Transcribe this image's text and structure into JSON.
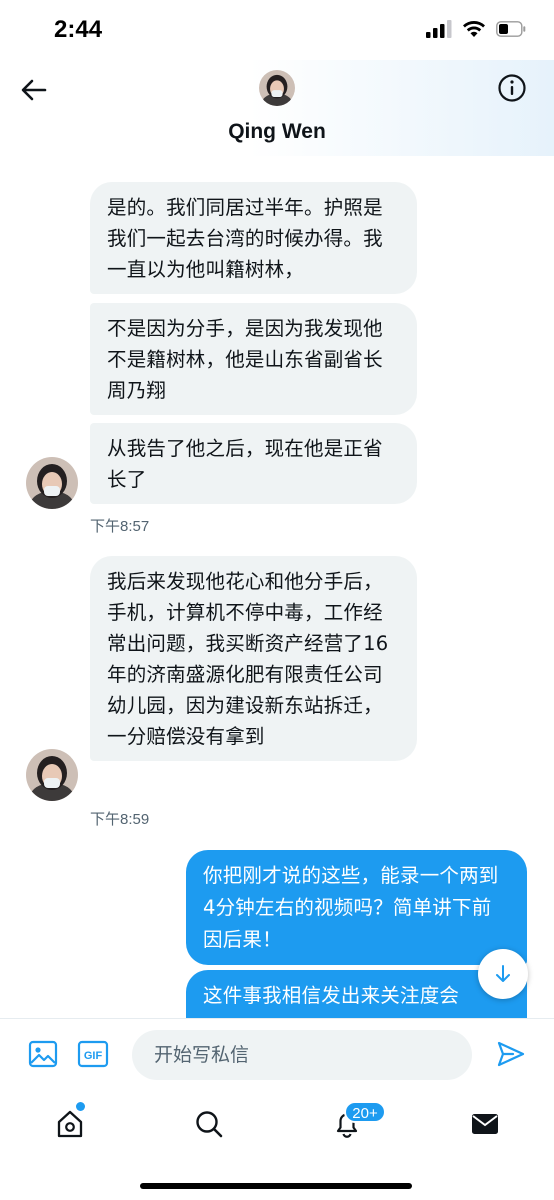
{
  "status_bar": {
    "time": "2:44"
  },
  "header": {
    "contact_name": "Qing Wen"
  },
  "messages": [
    {
      "text": "是的。我们同居过半年。护照是我们一起去台湾的时候办得。我一直以为他叫籍树林，"
    },
    {
      "text": "不是因为分手，是因为我发现他不是籍树林，他是山东省副省长周乃翔"
    },
    {
      "text": "从我告了他之后，现在他是正省长了"
    },
    {
      "text": "我后来发现他花心和他分手后，手机，计算机不停中毒，工作经常出问题，我买断资产经营了16年的济南盛源化肥有限责任公司幼儿园，因为建设新东站拆迁，一分赔偿没有拿到"
    },
    {
      "text": "你把刚才说的这些，能录一个两到4分钟左右的视频吗？简单讲下前因后果！"
    },
    {
      "text": "这件事我相信发出来关注度会"
    }
  ],
  "timestamps": {
    "t1": "下午8:57",
    "t2": "下午8:59"
  },
  "composer": {
    "placeholder": "开始写私信",
    "gif_label": "GIF"
  },
  "tabbar": {
    "notifications_badge": "20+"
  },
  "colors": {
    "accent": "#1d9bf0",
    "incoming_bubble": "#eff3f4",
    "text": "#0f1419",
    "muted": "#536471"
  },
  "icons": [
    "back-arrow-icon",
    "info-icon",
    "image-icon",
    "gif-icon",
    "send-icon",
    "home-icon",
    "search-icon",
    "bell-icon",
    "mail-icon",
    "arrow-down-icon",
    "signal-icon",
    "wifi-icon",
    "battery-icon"
  ]
}
